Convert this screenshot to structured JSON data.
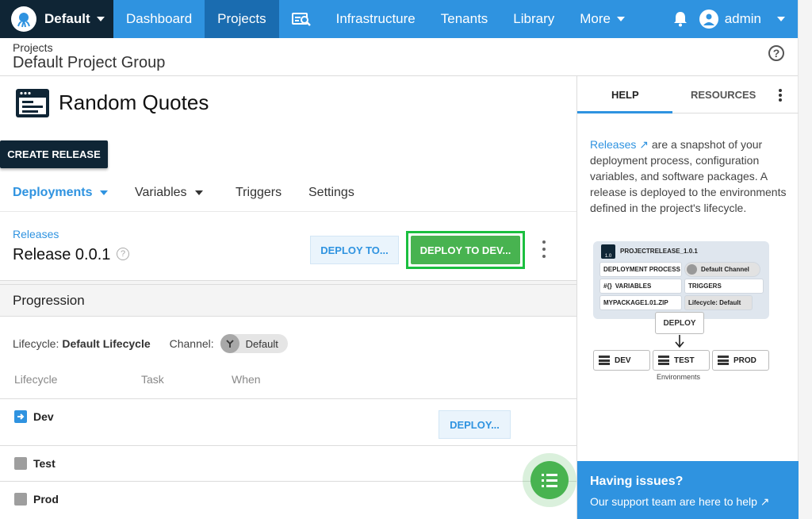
{
  "nav": {
    "space": "Default",
    "items": [
      "Dashboard",
      "Projects",
      "Infrastructure",
      "Tenants",
      "Library",
      "More"
    ],
    "active": "Projects",
    "user": "admin",
    "colors": {
      "nav": "#2f93e0",
      "active": "#1a6cb0",
      "space": "#0f2535"
    }
  },
  "breadcrumb": {
    "parent": "Projects",
    "title": "Default Project Group"
  },
  "project": {
    "name": "Random Quotes",
    "create_release": "CREATE RELEASE",
    "tabs": [
      "Deployments",
      "Variables",
      "Triggers",
      "Settings"
    ]
  },
  "release": {
    "link": "Releases",
    "name": "Release 0.0.1",
    "deploy_to": "DEPLOY TO...",
    "deploy_to_dev": "DEPLOY TO DEV..."
  },
  "progression": {
    "title": "Progression",
    "lifecycle_label": "Lifecycle:",
    "lifecycle_value": "Default Lifecycle",
    "channel_label": "Channel:",
    "channel_value": "Default",
    "columns": [
      "Lifecycle",
      "Task",
      "When"
    ],
    "rows": [
      {
        "name": "Dev",
        "action": "DEPLOY..."
      },
      {
        "name": "Test"
      },
      {
        "name": "Prod"
      }
    ]
  },
  "help_panel": {
    "tabs": [
      "HELP",
      "RESOURCES"
    ],
    "link": "Releases",
    "text": " are a snapshot of your deployment process, configuration variables, and software packages. A release is deployed to the environments defined in the project's lifecycle.",
    "diagram": {
      "release_name": "PROJECTRELEASE_1.0.1",
      "version_tag": "1.0",
      "deployment_process": "DEPLOYMENT PROCESS",
      "channel": "Default Channel",
      "variables": "VARIABLES",
      "variables_glyph": "#{}",
      "triggers": "TRIGGERS",
      "package": "MYPACKAGE1.01.ZIP",
      "lifecycle": "Lifecycle: Default",
      "deploy": "DEPLOY",
      "environments": [
        "DEV",
        "TEST",
        "PROD"
      ],
      "env_caption": "Environments"
    },
    "issues_title": "Having issues?",
    "issues_sub": "Our support team are here to help"
  }
}
